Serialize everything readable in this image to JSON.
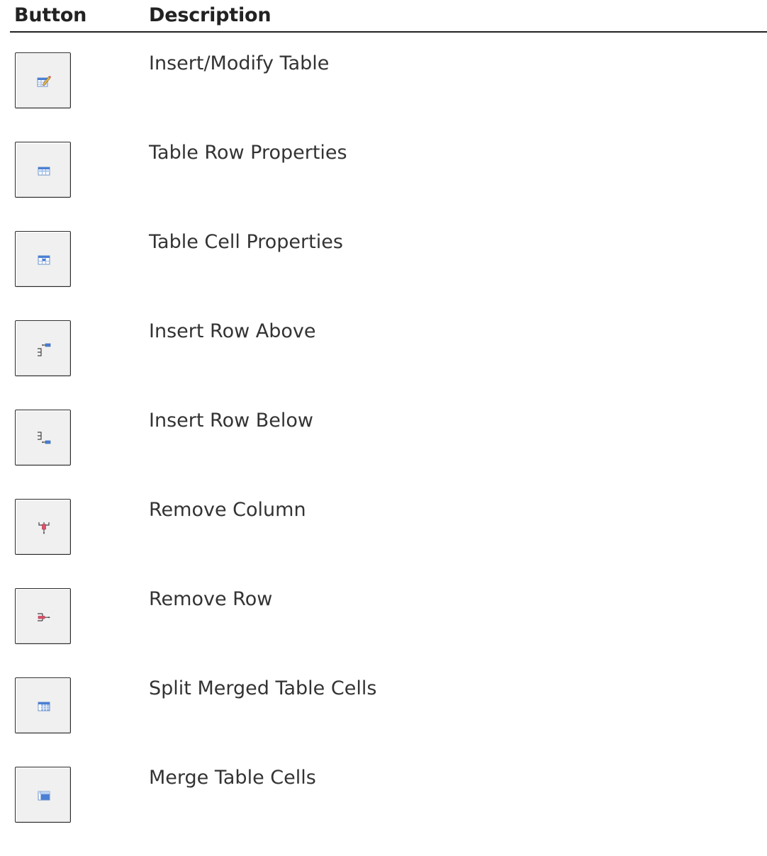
{
  "header": {
    "button_col": "Button",
    "description_col": "Description"
  },
  "rows": [
    {
      "icon": "insert-modify-table-icon",
      "description": "Insert/Modify Table"
    },
    {
      "icon": "table-row-properties-icon",
      "description": "Table Row Properties"
    },
    {
      "icon": "table-cell-properties-icon",
      "description": "Table Cell Properties"
    },
    {
      "icon": "insert-row-above-icon",
      "description": "Insert Row Above"
    },
    {
      "icon": "insert-row-below-icon",
      "description": "Insert Row Below"
    },
    {
      "icon": "remove-column-icon",
      "description": "Remove Column"
    },
    {
      "icon": "remove-row-icon",
      "description": "Remove Row"
    },
    {
      "icon": "split-merged-cells-icon",
      "description": "Split Merged Table Cells"
    },
    {
      "icon": "merge-cells-icon",
      "description": "Merge Table Cells"
    }
  ],
  "colors": {
    "icon_blue": "#4a7fd4",
    "icon_light_blue": "#bcd3f2",
    "icon_red": "#e0506a",
    "button_bg": "#f0f0f0",
    "header_rule": "#222222"
  }
}
